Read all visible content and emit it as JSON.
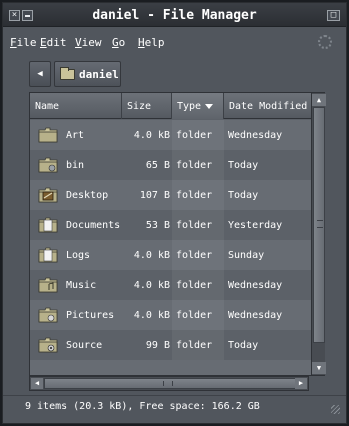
{
  "window": {
    "title": "daniel - File Manager",
    "close_glyph": "×",
    "maximize_glyph": "□"
  },
  "menubar": {
    "items": [
      {
        "key": "F",
        "rest": "ile"
      },
      {
        "key": "E",
        "rest": "dit"
      },
      {
        "key": "V",
        "rest": "iew"
      },
      {
        "key": "G",
        "rest": "o"
      },
      {
        "key": "H",
        "rest": "elp"
      }
    ]
  },
  "location": {
    "back_glyph": "◀",
    "crumb_label": "daniel"
  },
  "list": {
    "columns": {
      "name": "Name",
      "size": "Size",
      "type": "Type",
      "date": "Date Modified"
    },
    "sort_column": "Type",
    "sort_direction": "descending",
    "rows": [
      {
        "name": "Art",
        "size": "4.0 kB",
        "type": "folder",
        "date": "Wednesday",
        "icon": "folder-art-icon"
      },
      {
        "name": "bin",
        "size": "65 B",
        "type": "folder",
        "date": "Today",
        "icon": "folder-bin-icon"
      },
      {
        "name": "Desktop",
        "size": "107 B",
        "type": "folder",
        "date": "Today",
        "icon": "folder-desktop-icon"
      },
      {
        "name": "Documents",
        "size": "53 B",
        "type": "folder",
        "date": "Yesterday",
        "icon": "folder-documents-icon"
      },
      {
        "name": "Logs",
        "size": "4.0 kB",
        "type": "folder",
        "date": "Sunday",
        "icon": "folder-logs-icon"
      },
      {
        "name": "Music",
        "size": "4.0 kB",
        "type": "folder",
        "date": "Wednesday",
        "icon": "folder-music-icon"
      },
      {
        "name": "Pictures",
        "size": "4.0 kB",
        "type": "folder",
        "date": "Wednesday",
        "icon": "folder-pictures-icon"
      },
      {
        "name": "Source",
        "size": "99 B",
        "type": "folder",
        "date": "Today",
        "icon": "folder-source-icon"
      }
    ]
  },
  "scrollbars": {
    "up_glyph": "▲",
    "down_glyph": "▼",
    "left_glyph": "◀",
    "right_glyph": "▶"
  },
  "status": {
    "text": "9 items (20.3 kB), Free space: 166.2 GB"
  },
  "colors": {
    "window_bg": "#51565d",
    "list_row_odd": "#676c73",
    "list_row_even": "#5c6168",
    "folder": "#c9c39a",
    "text": "#ffffff"
  }
}
